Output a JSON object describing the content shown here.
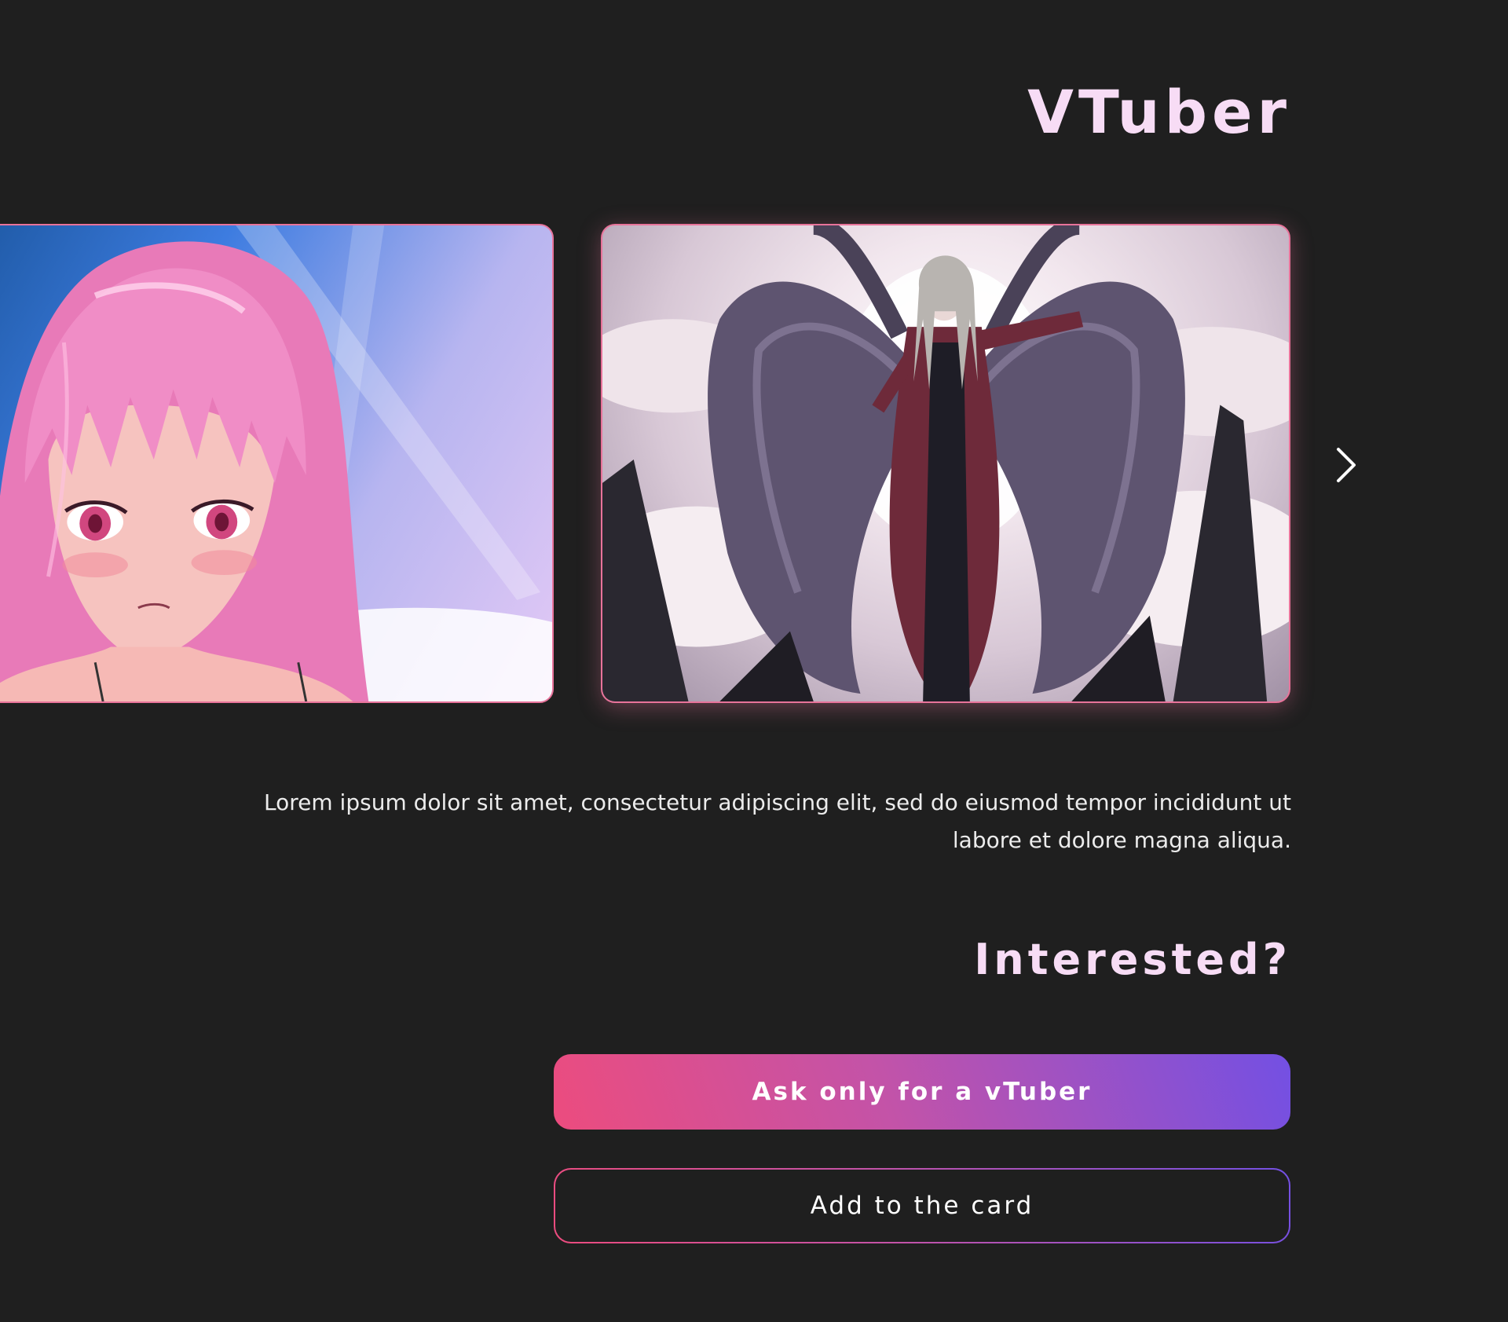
{
  "page": {
    "title": "VTuber",
    "description": "Lorem ipsum dolor sit amet, consectetur adipiscing elit, sed do eiusmod tempor incididunt ut labore et dolore magna aliqua.",
    "subtitle": "Interested?"
  },
  "carousel": {
    "items": [
      {
        "subject": "pink-haired-anime-girl"
      },
      {
        "subject": "winged-anime-man"
      }
    ],
    "next_icon": "chevron-right-icon"
  },
  "actions": {
    "primary_label": "Ask only for a vTuber",
    "secondary_label": "Add to the card"
  },
  "colors": {
    "background": "#1f1f1f",
    "heading": "#f7dcf5",
    "accent_pink": "#ec4c7e",
    "accent_magenta": "#c353a8",
    "accent_violet": "#7350e3",
    "card_border": "#e8739a"
  }
}
